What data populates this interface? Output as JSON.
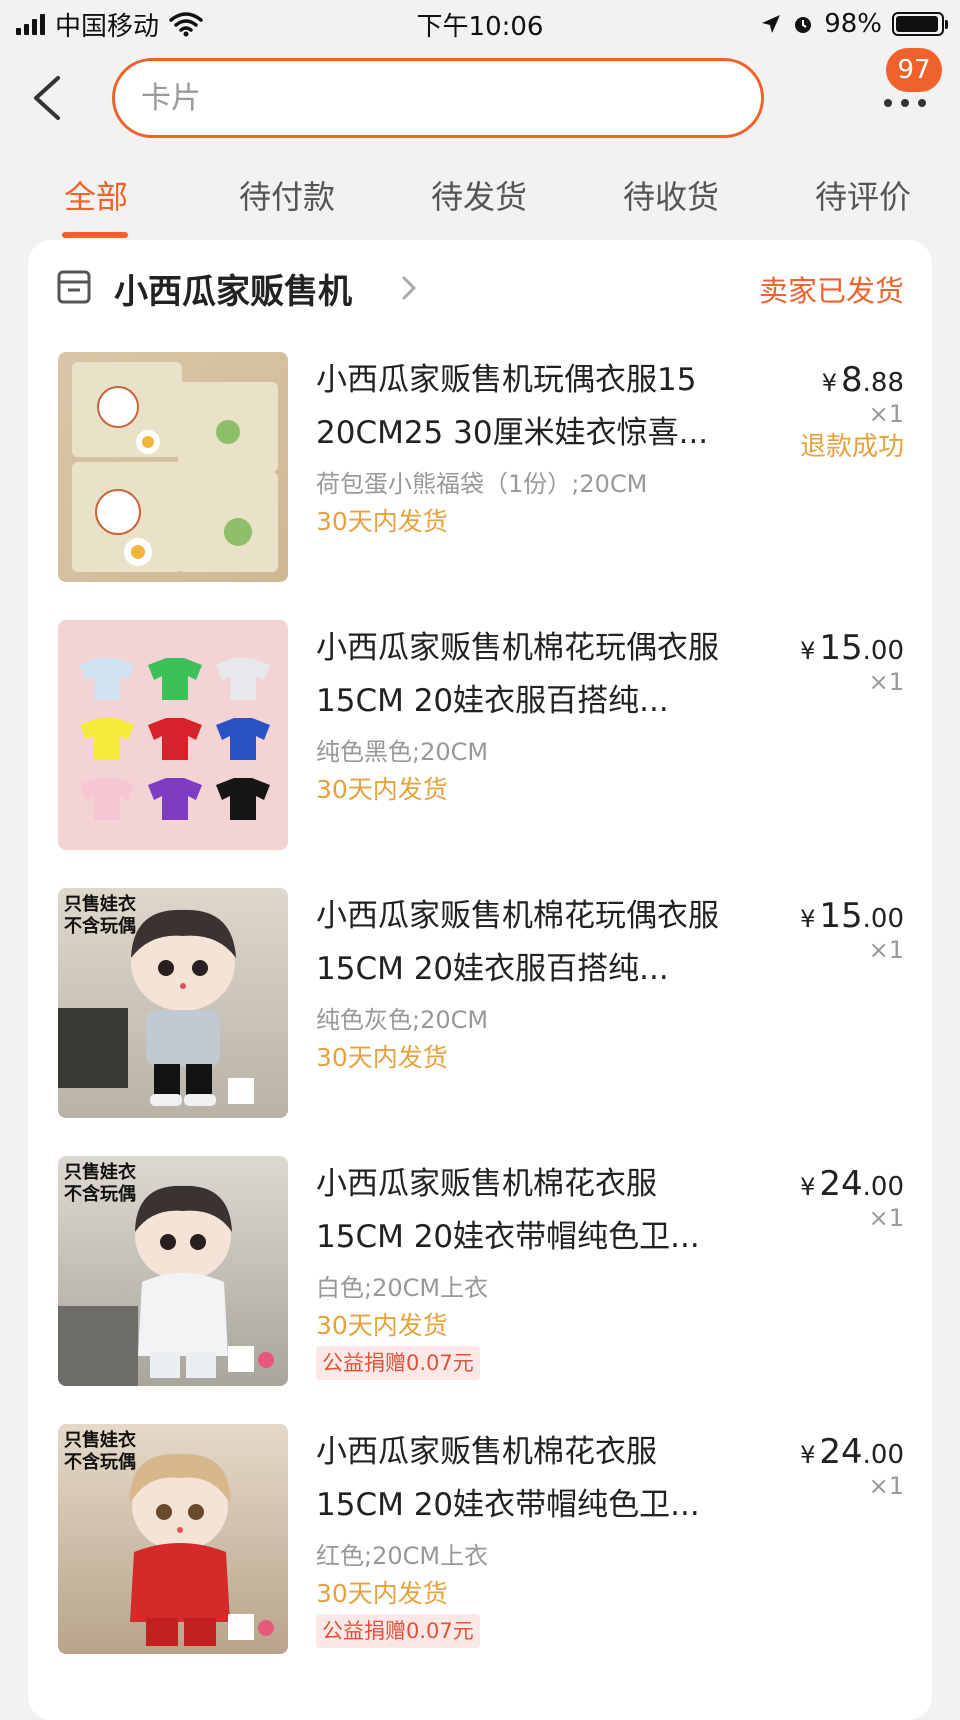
{
  "status_bar": {
    "carrier": "中国移动",
    "time": "下午10:06",
    "battery": "98%",
    "battery_level": 0.98
  },
  "nav": {
    "search_placeholder": "卡片",
    "badge_count": "97"
  },
  "tabs": [
    {
      "label": "全部",
      "active": true
    },
    {
      "label": "待付款",
      "active": false
    },
    {
      "label": "待发货",
      "active": false
    },
    {
      "label": "待收货",
      "active": false
    },
    {
      "label": "待评价",
      "active": false
    }
  ],
  "shop": {
    "name": "小西瓜家贩售机",
    "status": "卖家已发货"
  },
  "items": [
    {
      "title": "小西瓜家贩售机玩偶衣服15 20CM25 30厘米娃衣惊喜...",
      "sku": "荷包蛋小熊福袋（1份）;20CM",
      "ship": "30天内发货",
      "price_symbol": "¥",
      "price_int": "8",
      "price_dec": ".88",
      "qty": "×1",
      "refund": "退款成功"
    },
    {
      "title": "小西瓜家贩售机棉花玩偶衣服15CM 20娃衣服百搭纯...",
      "sku": "纯色黑色;20CM",
      "ship": "30天内发货",
      "price_symbol": "¥",
      "price_int": "15",
      "price_dec": ".00",
      "qty": "×1"
    },
    {
      "title": "小西瓜家贩售机棉花玩偶衣服15CM 20娃衣服百搭纯...",
      "sku": "纯色灰色;20CM",
      "ship": "30天内发货",
      "price_symbol": "¥",
      "price_int": "15",
      "price_dec": ".00",
      "qty": "×1",
      "image_label": "只售娃衣\n不含玩偶"
    },
    {
      "title": "小西瓜家贩售机棉花衣服15CM 20娃衣带帽纯色卫...",
      "sku": "白色;20CM上衣",
      "ship": "30天内发货",
      "charity": "公益捐赠0.07元",
      "price_symbol": "¥",
      "price_int": "24",
      "price_dec": ".00",
      "qty": "×1",
      "image_label": "只售娃衣\n不含玩偶"
    },
    {
      "title": "小西瓜家贩售机棉花衣服15CM 20娃衣带帽纯色卫...",
      "sku": "红色;20CM上衣",
      "ship": "30天内发货",
      "charity": "公益捐赠0.07元",
      "price_symbol": "¥",
      "price_int": "24",
      "price_dec": ".00",
      "qty": "×1",
      "image_label": "只售娃衣\n不含玩偶"
    }
  ],
  "colors": {
    "accent": "#f0622c",
    "ship_text": "#e6a23c"
  }
}
